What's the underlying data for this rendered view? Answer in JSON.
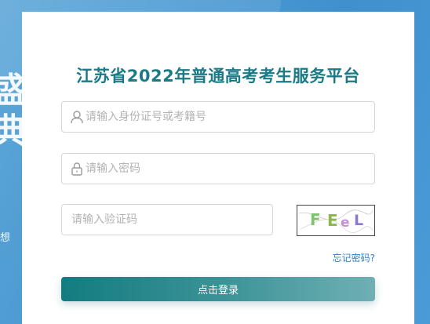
{
  "background": {
    "calligraphy": [
      "盛",
      "典"
    ],
    "motto": "想 事"
  },
  "form": {
    "title": "江苏省2022年普通高考考生服务平台",
    "username_placeholder": "请输入身份证号或考籍号",
    "password_placeholder": "请输入密码",
    "captcha_placeholder": "请输入验证码",
    "captcha_text": [
      "F",
      "E",
      "e",
      "L"
    ],
    "forgot_label": "忘记密码?",
    "login_label": "点击登录"
  },
  "colors": {
    "title": "#1a7a86",
    "link": "#2f7fc9",
    "button_start": "#137c80",
    "button_end": "#6fb0b4"
  }
}
